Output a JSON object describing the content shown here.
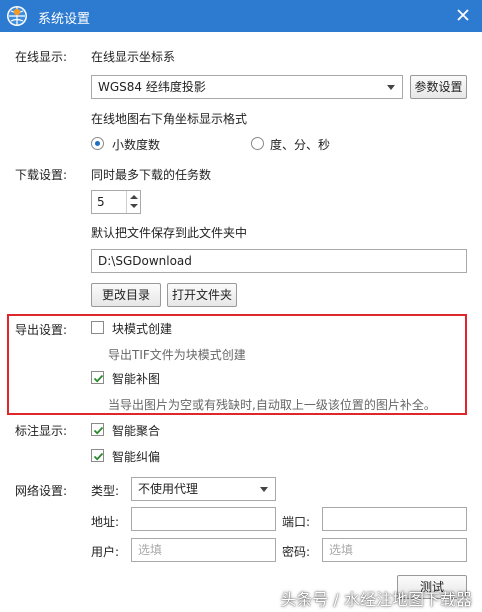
{
  "window": {
    "title": "系统设置"
  },
  "online": {
    "label": "在线显示:",
    "coord_label": "在线显示坐标系",
    "coord_value": "WGS84 经纬度投影",
    "param_button": "参数设置",
    "format_label": "在线地图右下角坐标显示格式",
    "format_option_decimal": "小数度数",
    "format_option_dms": "度、分、秒",
    "selected_format": "小数度数"
  },
  "download": {
    "label": "下载设置:",
    "tasks_label": "同时最多下载的任务数",
    "tasks_value": "5",
    "folder_label": "默认把文件保存到此文件夹中",
    "folder_value": "D:\\SGDownload",
    "change_dir_button": "更改目录",
    "open_folder_button": "打开文件夹"
  },
  "export": {
    "label": "导出设置:",
    "block_mode": {
      "label": "块模式创建",
      "checked": false,
      "hint": "导出TIF文件为块模式创建"
    },
    "smart_fill": {
      "label": "智能补图",
      "checked": true,
      "hint": "当导出图片为空或有残缺时,自动取上一级该位置的图片补全。"
    },
    "highlight_color": "#e0262a"
  },
  "annotation": {
    "label": "标注显示:",
    "smart_merge": {
      "label": "智能聚合",
      "checked": true
    },
    "smart_rectify": {
      "label": "智能纠偏",
      "checked": true
    }
  },
  "network": {
    "label": "网络设置:",
    "type_label": "类型:",
    "type_value": "不使用代理",
    "address_label": "地址:",
    "address_value": "",
    "port_label": "端口:",
    "port_value": "",
    "user_label": "用户:",
    "user_placeholder": "选填",
    "password_label": "密码:",
    "password_placeholder": "选填",
    "test_button": "测试"
  },
  "watermark": "头条号 / 水经注地图下载器",
  "colors": {
    "titlebar": "#2d7bd1",
    "accent": "#1e6fc4",
    "check": "#2a8a2a"
  }
}
